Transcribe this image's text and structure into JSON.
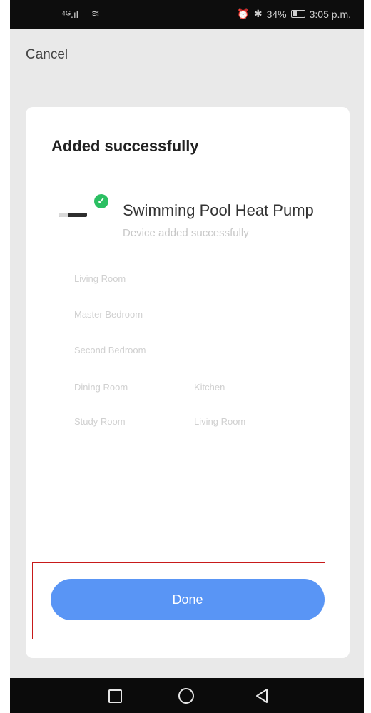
{
  "status_bar": {
    "signal": "⁴ᴳ.ıl",
    "wifi": "≋",
    "alarm": "⏰",
    "bluetooth": "✱",
    "battery_percent": "34%",
    "time": "3:05 p.m."
  },
  "header": {
    "cancel_label": "Cancel"
  },
  "card": {
    "title": "Added successfully",
    "device": {
      "name": "Swimming Pool Heat Pump",
      "status": "Device added successfully"
    },
    "rooms": [
      "Living Room",
      "Master Bedroom",
      "Second Bedroom",
      "Dining Room",
      "Kitchen",
      "Study Room",
      "Living Room"
    ],
    "done_label": "Done"
  },
  "colors": {
    "accent": "#5995f5",
    "success": "#2bbf62",
    "highlight": "#c71a1a"
  },
  "icons": {
    "check": "✓",
    "nav_back": "◁"
  }
}
